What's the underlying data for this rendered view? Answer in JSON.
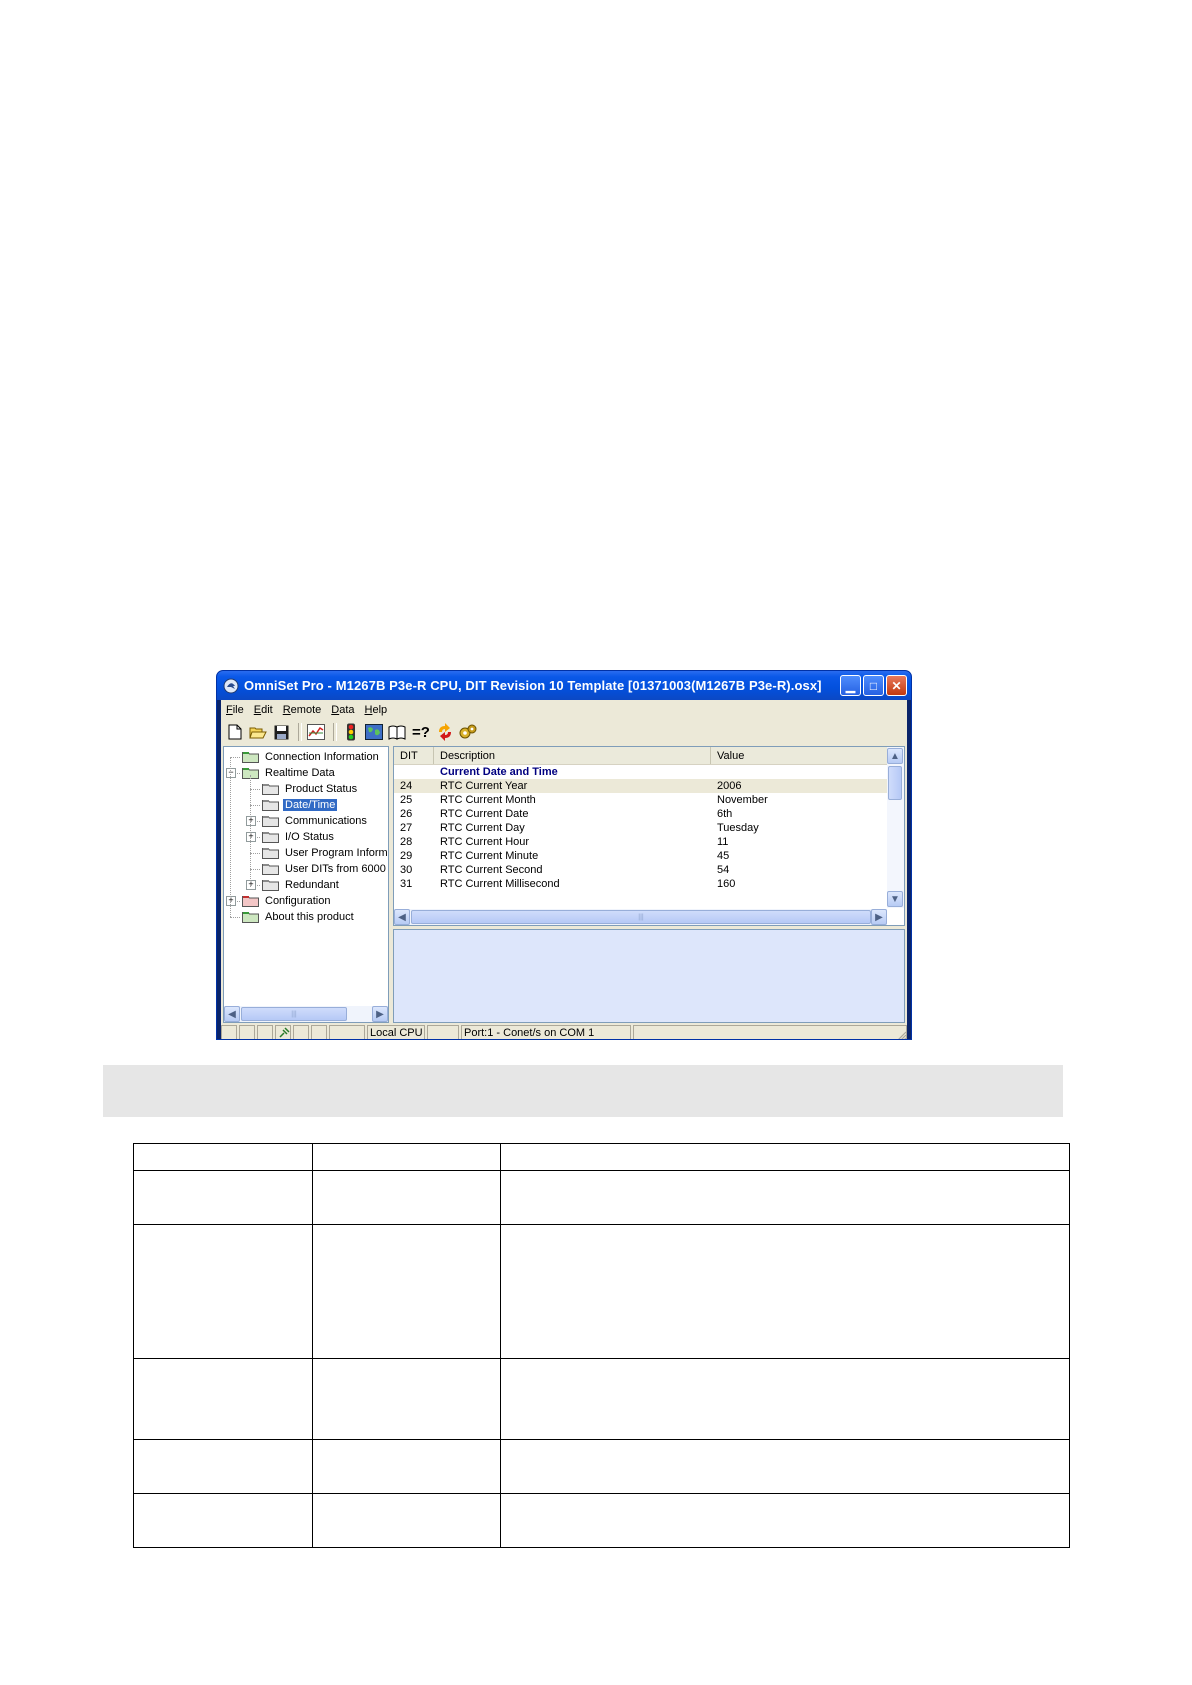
{
  "window": {
    "title": "OmniSet Pro - M1267B P3e-R CPU, DIT Revision 10 Template [01371003(M1267B P3e-R).osx]",
    "menu": [
      {
        "key": "F",
        "rest": "ile"
      },
      {
        "key": "E",
        "rest": "dit"
      },
      {
        "key": "R",
        "rest": "emote"
      },
      {
        "key": "D",
        "rest": "ata"
      },
      {
        "key": "H",
        "rest": "elp"
      }
    ],
    "toolbar": {
      "icons": [
        "new-document-icon",
        "open-folder-icon",
        "save-disk-icon",
        "chart-icon",
        "traffic-light-icon",
        "world-icon",
        "book-icon",
        "compare-icon",
        "refresh-arrows-icon",
        "gears-icon"
      ],
      "compare_label": "=?"
    },
    "accent_colors": {
      "selection": "#316ac5",
      "section_title": "#000080",
      "title_bar": "#0350dc"
    }
  },
  "tree": {
    "items": [
      {
        "label": "Connection Information",
        "level": 0,
        "expander": "",
        "folder": "green"
      },
      {
        "label": "Realtime Data",
        "level": 0,
        "expander": "−",
        "folder": "green"
      },
      {
        "label": "Product Status",
        "level": 1,
        "expander": "",
        "folder": "gray"
      },
      {
        "label": "Date/Time",
        "level": 1,
        "expander": "",
        "folder": "gray",
        "selected": true
      },
      {
        "label": "Communications",
        "level": 1,
        "expander": "+",
        "folder": "gray"
      },
      {
        "label": "I/O Status",
        "level": 1,
        "expander": "+",
        "folder": "gray"
      },
      {
        "label": "User Program Informa",
        "level": 1,
        "expander": "",
        "folder": "gray"
      },
      {
        "label": "User DITs from 6000",
        "level": 1,
        "expander": "",
        "folder": "gray"
      },
      {
        "label": "Redundant",
        "level": 1,
        "expander": "+",
        "folder": "gray"
      },
      {
        "label": "Configuration",
        "level": 0,
        "expander": "+",
        "folder": "red"
      },
      {
        "label": "About this product",
        "level": 0,
        "expander": "",
        "folder": "green"
      }
    ]
  },
  "list": {
    "columns": [
      "DIT",
      "Description",
      "Value"
    ],
    "section_title": "Current Date and Time",
    "rows": [
      {
        "dit": "24",
        "description": "RTC Current Year",
        "value": "2006"
      },
      {
        "dit": "25",
        "description": "RTC Current Month",
        "value": "November"
      },
      {
        "dit": "26",
        "description": "RTC Current Date",
        "value": "6th"
      },
      {
        "dit": "27",
        "description": "RTC Current Day",
        "value": "Tuesday"
      },
      {
        "dit": "28",
        "description": "RTC Current Hour",
        "value": "11"
      },
      {
        "dit": "29",
        "description": "RTC Current Minute",
        "value": "45"
      },
      {
        "dit": "30",
        "description": "RTC Current Second",
        "value": "54"
      },
      {
        "dit": "31",
        "description": "RTC Current Millisecond",
        "value": "160"
      }
    ]
  },
  "statusbar": {
    "location": "Local CPU",
    "port": "Port:1 - Conet/s on COM 1"
  },
  "doc_table": {
    "rows": 6,
    "cols": 3
  }
}
